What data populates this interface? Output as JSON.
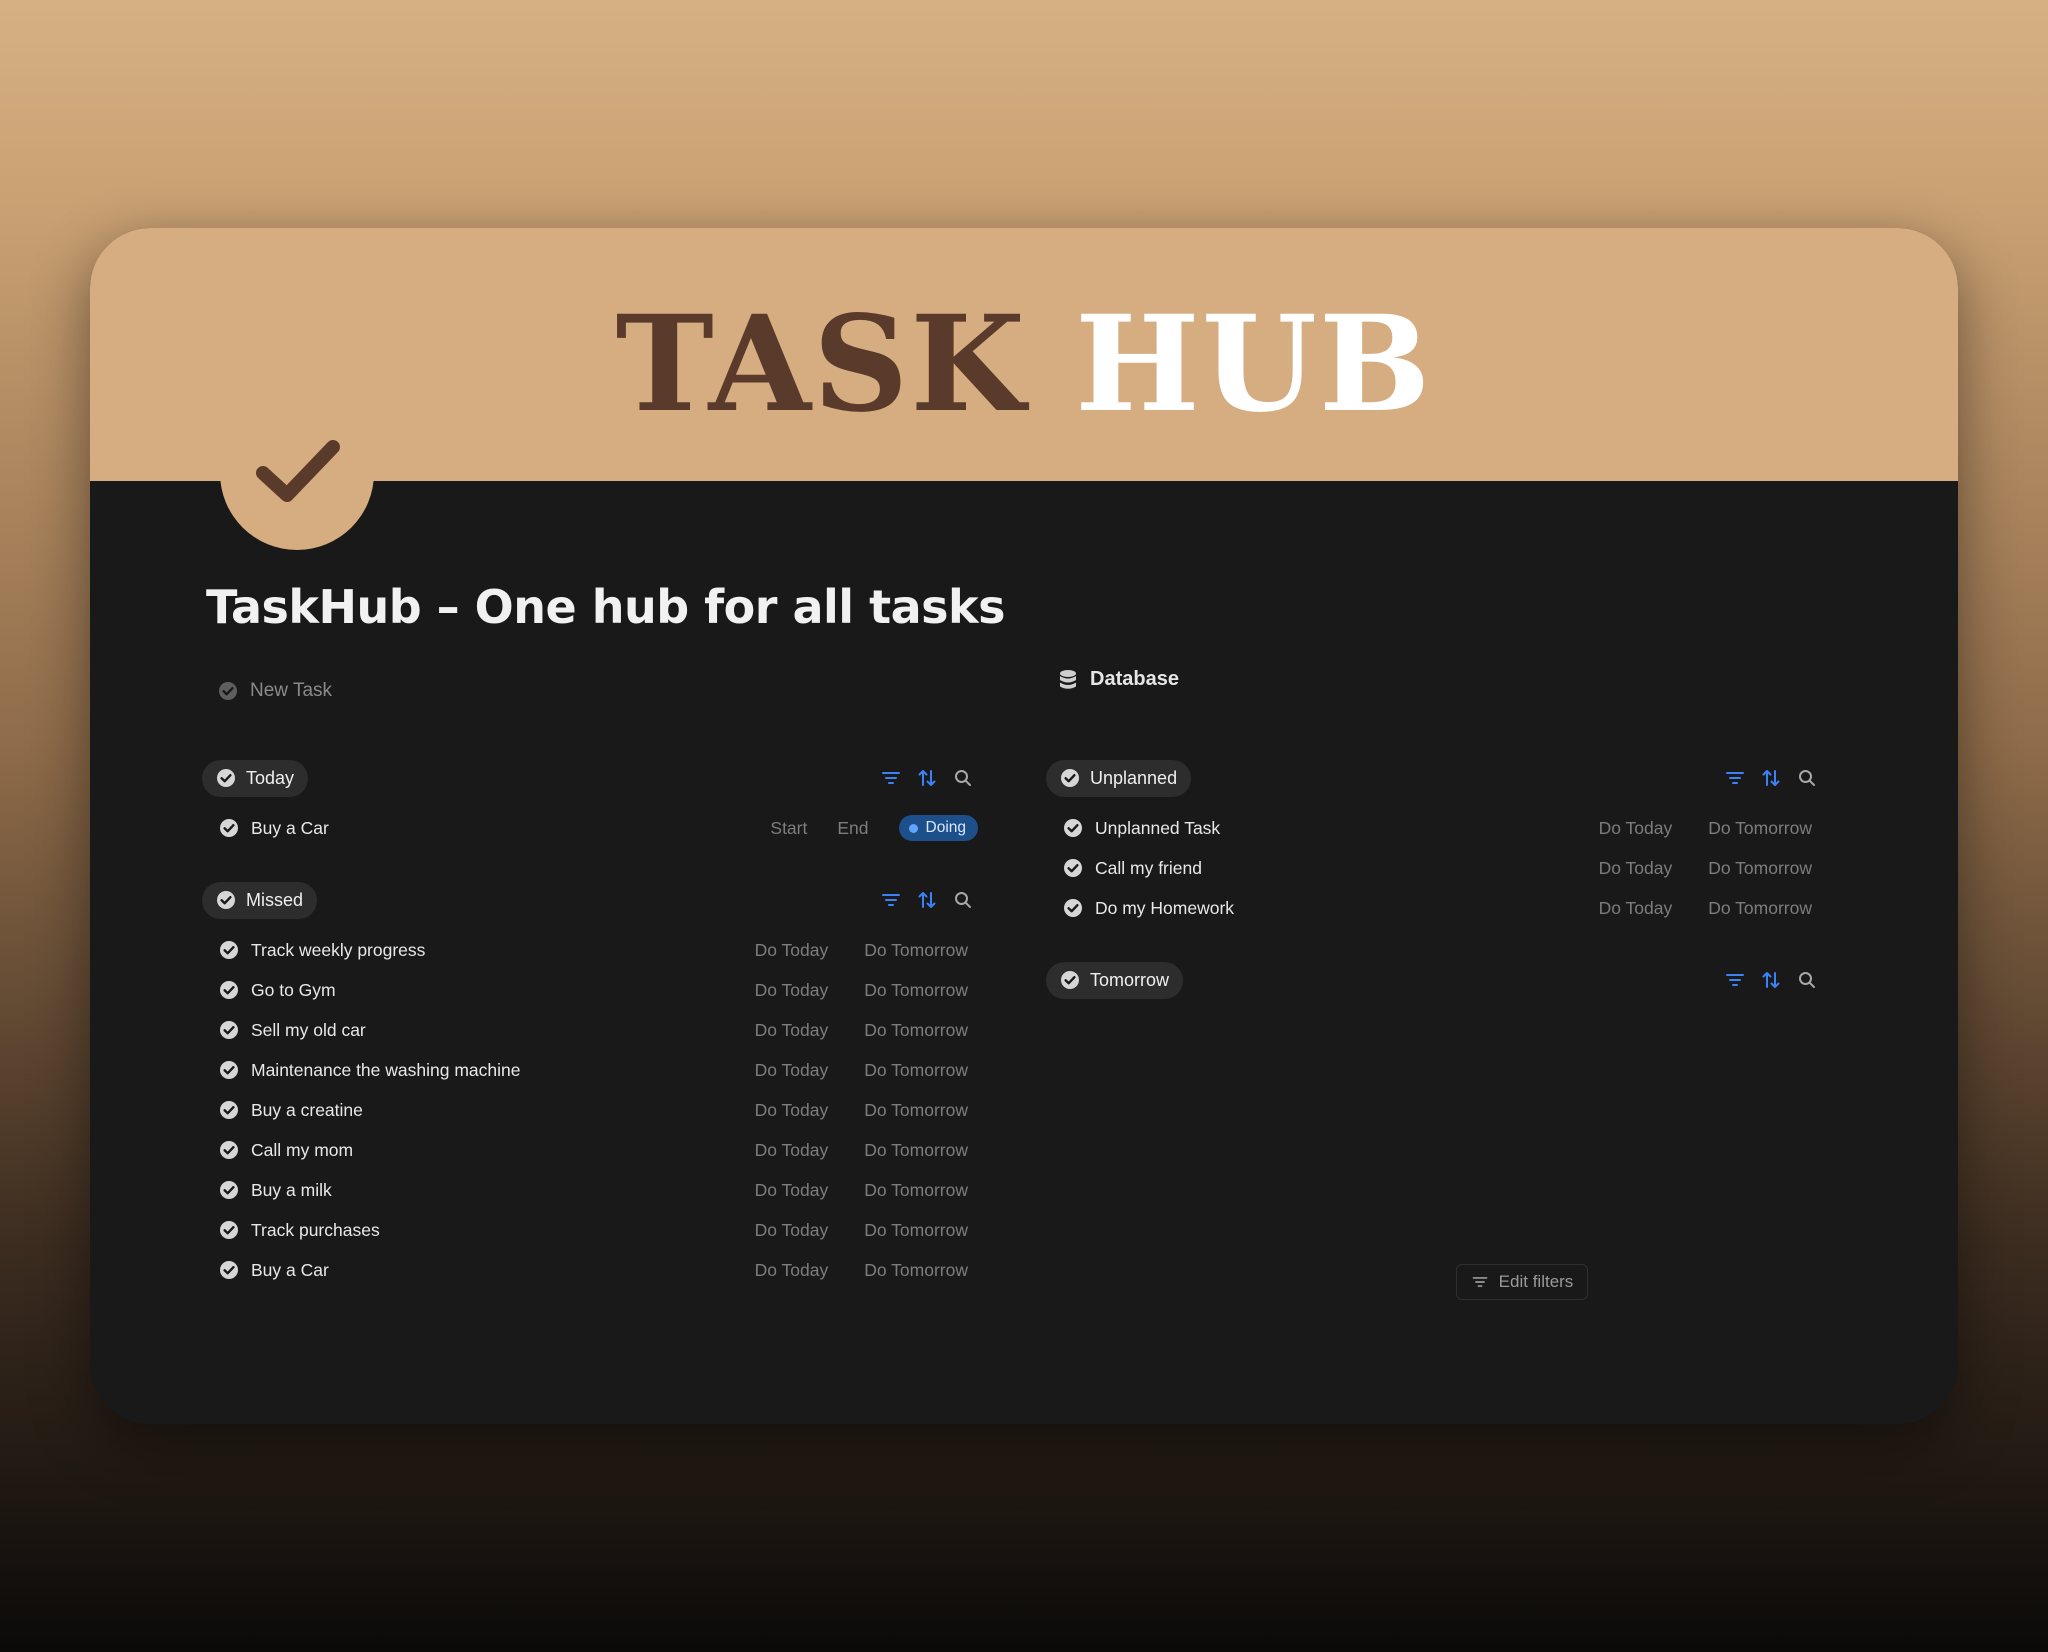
{
  "banner": {
    "title_part1": "TASK",
    "title_part2": "HUB"
  },
  "page": {
    "title": "TaskHub – One hub for all tasks"
  },
  "new_task": {
    "label": "New Task"
  },
  "database": {
    "label": "Database"
  },
  "colors": {
    "accent_tan": "#d5ad80",
    "accent_brown": "#5a3a2b",
    "card_bg": "#191919",
    "doing_blue": "#1d4f8a",
    "tool_blue": "#3b82f6"
  },
  "today_view": {
    "label": "Today",
    "rows": [
      {
        "name": "Buy a Car",
        "start": "Start",
        "end": "End",
        "status": "Doing"
      }
    ]
  },
  "missed_view": {
    "label": "Missed",
    "do_today": "Do Today",
    "do_tomorrow": "Do Tomorrow",
    "rows": [
      "Track weekly progress",
      "Go to Gym",
      "Sell my old car",
      "Maintenance the washing machine",
      "Buy a creatine",
      "Call my mom",
      "Buy a milk",
      "Track purchases",
      "Buy a Car"
    ]
  },
  "unplanned_view": {
    "label": "Unplanned",
    "do_today": "Do Today",
    "do_tomorrow": "Do Tomorrow",
    "rows": [
      "Unplanned Task",
      "Call my friend",
      "Do my Homework"
    ]
  },
  "tomorrow_view": {
    "label": "Tomorrow",
    "edit_filters": "Edit filters"
  },
  "icons": [
    "check-circle-icon",
    "filter-icon",
    "sort-icon",
    "search-icon",
    "database-icon",
    "checkmark-icon"
  ]
}
